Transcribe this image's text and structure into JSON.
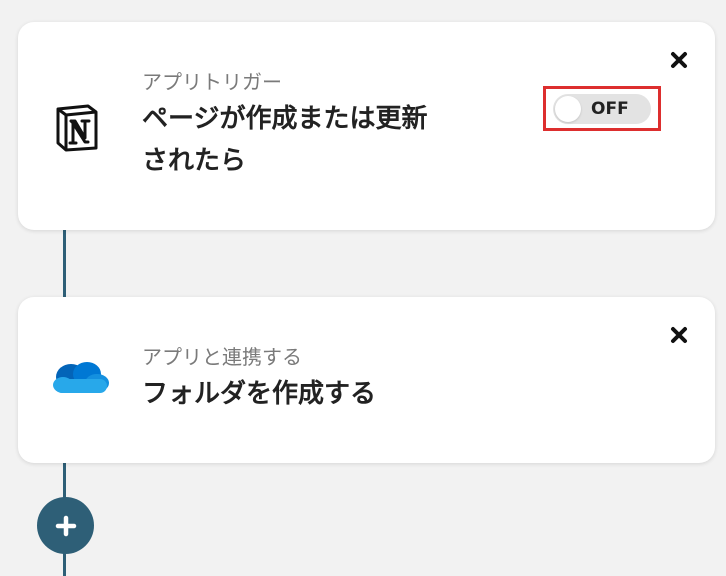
{
  "flow": {
    "trigger_step": {
      "subtitle": "アプリトリガー",
      "title": "ページが作成または更新されたら",
      "toggle_label": "OFF",
      "toggle_on": false,
      "app_icon": "notion-icon"
    },
    "action_step": {
      "subtitle": "アプリと連携する",
      "title": "フォルダを作成する",
      "app_icon": "onedrive-icon"
    },
    "add_step_icon": "plus-icon"
  },
  "colors": {
    "background": "#f2f2f2",
    "connector": "#2e5f77",
    "highlight": "#dd2e2e",
    "toggle_off": "#e3e3e3"
  }
}
